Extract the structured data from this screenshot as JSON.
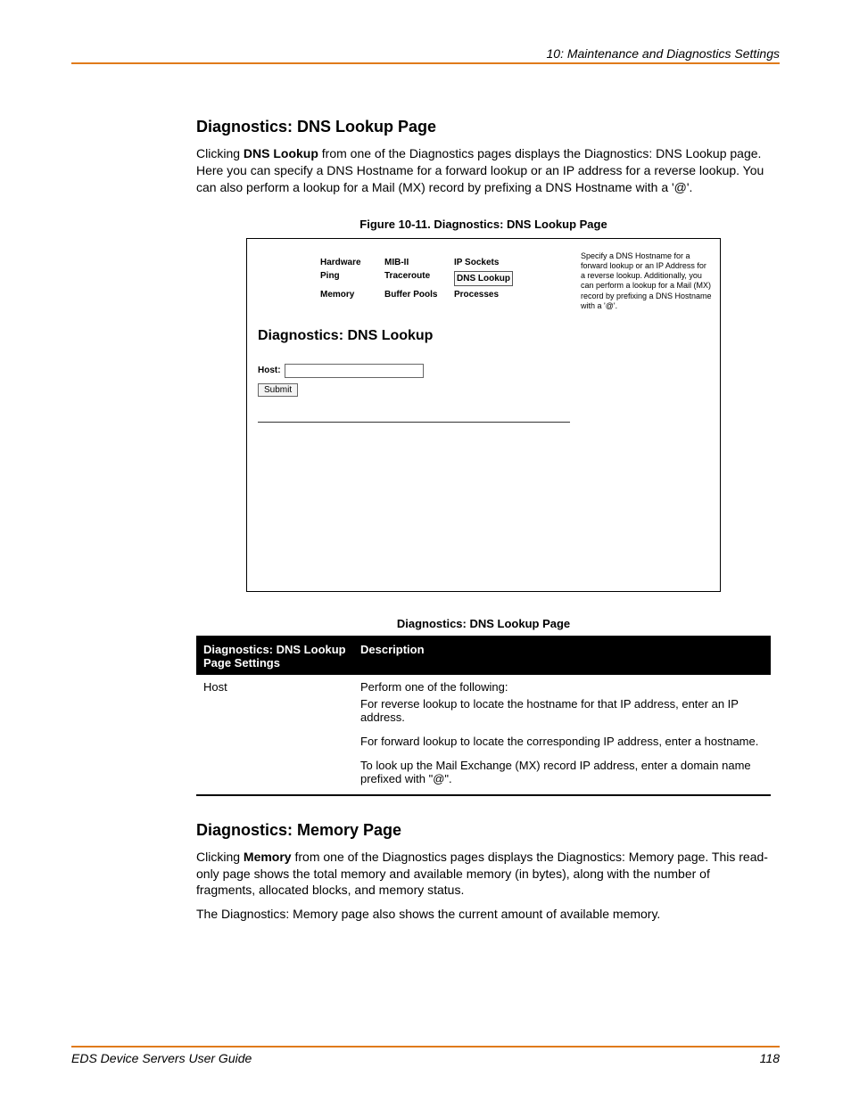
{
  "header": {
    "chapter": "10: Maintenance and Diagnostics Settings"
  },
  "section1": {
    "title": "Diagnostics: DNS Lookup Page",
    "intro_pre": "Clicking ",
    "intro_bold": "DNS Lookup",
    "intro_post": " from one of the Diagnostics pages displays the Diagnostics: DNS Lookup page. Here you can specify a DNS Hostname for a forward lookup or an IP address for a reverse lookup. You can also perform a lookup for a Mail (MX) record by prefixing a DNS Hostname with a '@'."
  },
  "figure": {
    "caption": "Figure 10-11. Diagnostics: DNS Lookup Page",
    "nav": {
      "r1c1": "Hardware",
      "r1c2": "MIB-II",
      "r1c3": "IP Sockets",
      "r2c1": "Ping",
      "r2c2": "Traceroute",
      "r2c3": "DNS Lookup",
      "r3c1": "Memory",
      "r3c2": "Buffer Pools",
      "r3c3": "Processes"
    },
    "help_text": "Specify a DNS Hostname for a forward lookup or an IP Address for a reverse lookup. Additionally, you can perform a lookup for a Mail (MX) record by prefixing a DNS Hostname with a '@'.",
    "inner_title": "Diagnostics: DNS Lookup",
    "host_label": "Host:",
    "submit_label": "Submit"
  },
  "table": {
    "caption": "Diagnostics: DNS Lookup Page",
    "col1": "Diagnostics: DNS Lookup Page Settings",
    "col2": "Description",
    "row_label": "Host",
    "desc1": "Perform one of the following:",
    "desc2": "For reverse lookup to locate the hostname for that IP address, enter an IP address.",
    "desc3": "For forward lookup to locate the corresponding IP address, enter a hostname.",
    "desc4": "To look up the Mail Exchange (MX) record IP address, enter a domain name prefixed with \"@\"."
  },
  "section2": {
    "title": "Diagnostics: Memory Page",
    "p1_pre": "Clicking ",
    "p1_bold": "Memory",
    "p1_post": " from one of the Diagnostics pages displays the Diagnostics: Memory page. This read-only page shows the total memory and available memory (in bytes), along with the number of fragments, allocated blocks, and memory status.",
    "p2": "The Diagnostics: Memory page also shows the current amount of available memory."
  },
  "footer": {
    "left": "EDS Device Servers User Guide",
    "right": "118"
  }
}
